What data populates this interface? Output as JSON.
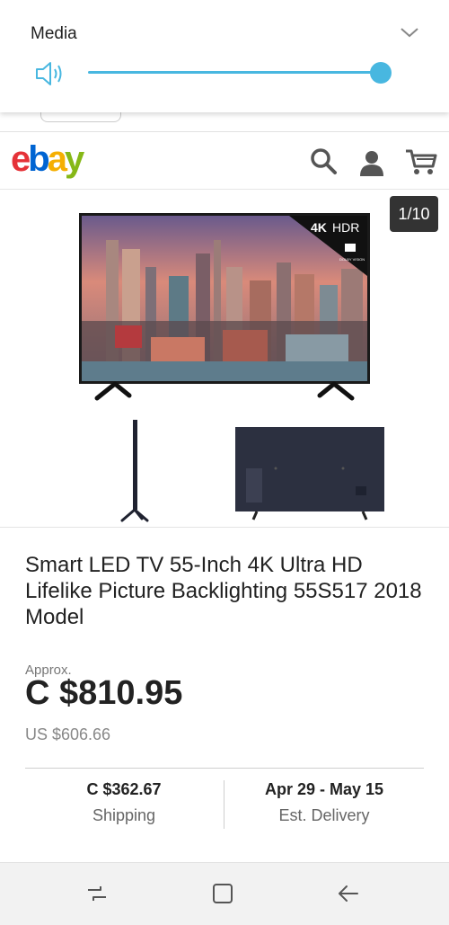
{
  "volume": {
    "title": "Media",
    "level_percent": 100,
    "accent_color": "#48b7e0",
    "icons": {
      "expand": "chevron-down-icon",
      "speaker": "speaker-icon"
    }
  },
  "header": {
    "logo_letters": [
      "e",
      "b",
      "a",
      "y"
    ],
    "icons": [
      "search-icon",
      "account-icon",
      "cart-icon"
    ]
  },
  "gallery": {
    "counter": "1/10",
    "badge_4k": "4K",
    "badge_hdr": "HDR",
    "badge_dolby": "DOLBY VISION"
  },
  "product": {
    "title": "Smart LED TV 55-Inch 4K Ultra HD Lifelike Picture Backlighting 55S517 2018 Model",
    "approx_label": "Approx.",
    "price": "C $810.95",
    "usd_price": "US $606.66"
  },
  "info": {
    "shipping_value": "C $362.67",
    "shipping_label": "Shipping",
    "delivery_value": "Apr 29 - May 15",
    "delivery_label": "Est. Delivery"
  },
  "navbar": {
    "icons": [
      "recent-apps-icon",
      "home-icon",
      "back-icon"
    ]
  }
}
